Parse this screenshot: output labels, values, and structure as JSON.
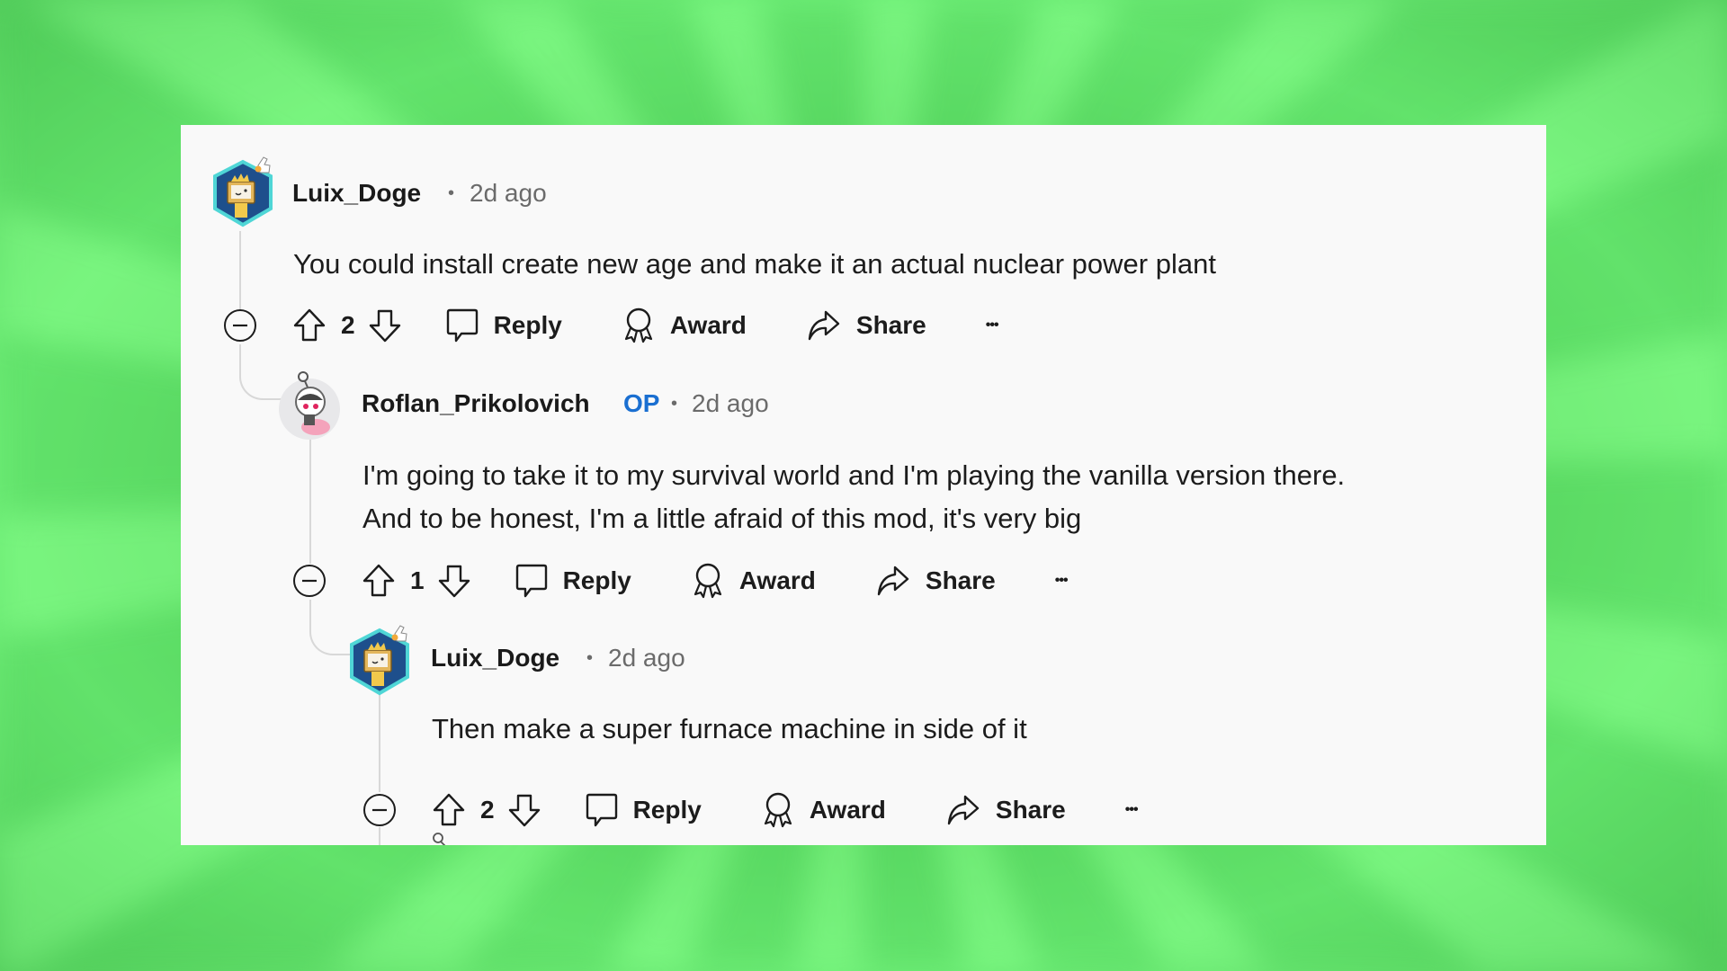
{
  "comments": [
    {
      "author": "Luix_Doge",
      "op_badge": "",
      "separator": "•",
      "time": "2d ago",
      "lines": [
        "You could install create new age and make it an actual nuclear power plant"
      ],
      "score": "2",
      "avatar": "robot-tv-hexagon-avatar"
    },
    {
      "author": "Roflan_Prikolovich",
      "op_badge": "OP",
      "separator": "•",
      "time": "2d ago",
      "lines": [
        "I'm going to take it to my survival world and I'm playing the vanilla version there.",
        "And to be honest, I'm a little afraid of this mod, it's very big"
      ],
      "score": "1",
      "avatar": "astronaut-snoo-avatar"
    },
    {
      "author": "Luix_Doge",
      "op_badge": "",
      "separator": "•",
      "time": "2d ago",
      "lines": [
        "Then make a super furnace machine in side of it"
      ],
      "score": "2",
      "avatar": "robot-tv-hexagon-avatar"
    }
  ],
  "actions": {
    "reply": "Reply",
    "award": "Award",
    "share": "Share",
    "more": "•••"
  },
  "colors": {
    "op_badge": "#1a6fd1",
    "background_green": "#62e06a",
    "card": "#f9f9f9"
  }
}
